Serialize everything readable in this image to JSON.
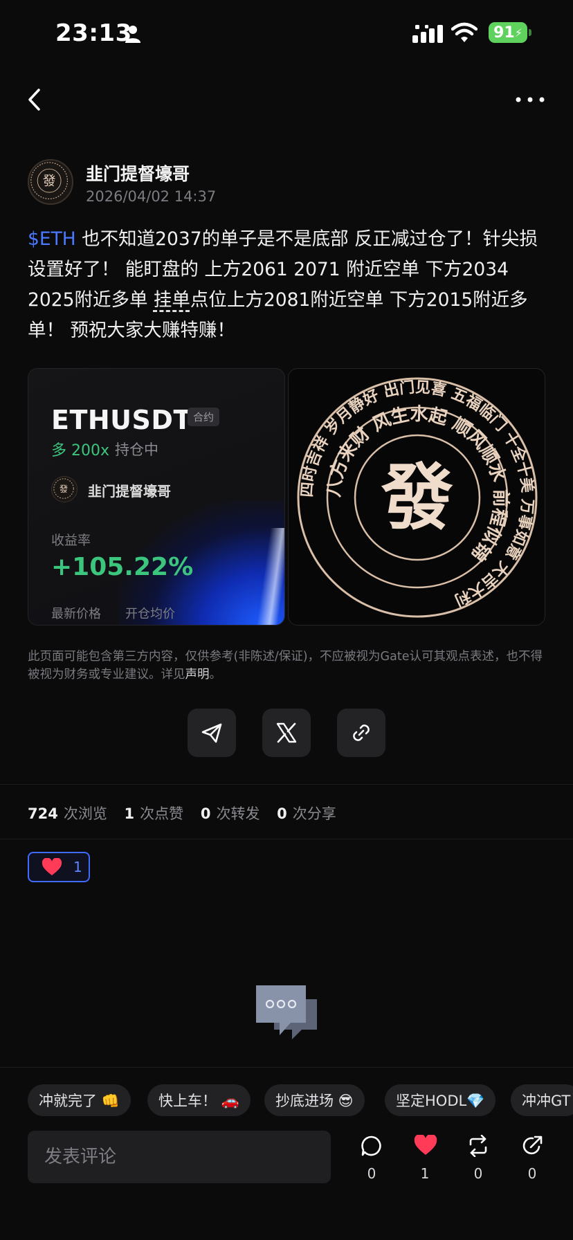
{
  "status_bar": {
    "time": "23:13",
    "battery": "91"
  },
  "post": {
    "author": "韭门提督壕哥",
    "date": "2026/04/02 14:37",
    "ticker": "$ETH",
    "text_1": " 也不知道2037的单子是不是底部 反正减过仓了！针尖损设置好了！  能盯盘的 上方2061 2071 附近空单  下方2034 2025附近多单  ",
    "text_link": "挂单",
    "text_2": "点位上方2081附近空单  下方2015附近多单！ 预祝大家大赚特赚！"
  },
  "trade_card": {
    "pair": "ETHUSDT",
    "contract_badge": "合约",
    "leverage": "多 200x",
    "position_status": "持仓中",
    "author": "韭门提督壕哥",
    "yield_label": "收益率",
    "yield_value": "+105.22%",
    "last_price_label": "最新价格",
    "entry_price_label": "开仓均价"
  },
  "seal_card": {
    "center_char": "發",
    "outer_text": "四时吉祥  岁月静好  出门见喜  五福临门  十全十美  万事如意  大吉大利",
    "middle_text": "八方来财  风生水起  顺风顺水  前程似锦"
  },
  "disclaimer": {
    "text": "此页面可能包含第三方内容，仅供参考(非陈述/保证)，不应被视为Gate认可其观点表述，也不得被视为财务或专业建议。详见",
    "link": "声明",
    "end": "。"
  },
  "stats": {
    "views": "724",
    "views_label": "次浏览",
    "likes": "1",
    "likes_label": "次点赞",
    "reposts": "0",
    "reposts_label": "次转发",
    "shares": "0",
    "shares_label": "次分享"
  },
  "reaction": {
    "emoji_icon": "heart-icon",
    "count": "1"
  },
  "quick_replies": [
    "冲就完了 👊",
    "快上车！ 🚗",
    "抄底进场 😎",
    "坚定HODL💎",
    "冲冲GT"
  ],
  "comment": {
    "placeholder": "发表评论"
  },
  "actions": {
    "comments": "0",
    "likes": "1",
    "reposts": "0",
    "shares": "0"
  },
  "colors": {
    "accent": "#4a79ff",
    "positive": "#3cc57d",
    "like": "#ff3b57",
    "background": "#0b0b0c"
  }
}
